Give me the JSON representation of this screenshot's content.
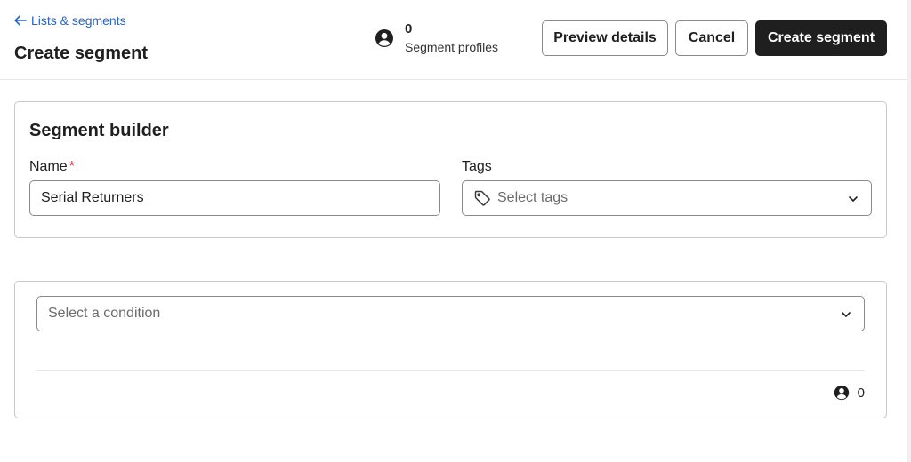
{
  "header": {
    "back_link": "Lists & segments",
    "title": "Create segment",
    "profile_count": "0",
    "profile_label": "Segment profiles",
    "preview_button": "Preview details",
    "cancel_button": "Cancel",
    "create_button": "Create segment"
  },
  "builder": {
    "title": "Segment builder",
    "name_label": "Name",
    "required_mark": "*",
    "name_value": "Serial Returners",
    "tags_label": "Tags",
    "tags_placeholder": "Select tags"
  },
  "condition": {
    "placeholder": "Select a condition",
    "count": "0"
  },
  "icons": {
    "back": "arrow-left-icon",
    "profiles": "user-circle-icon",
    "tag": "tag-icon",
    "dropdown": "chevron-down-icon"
  },
  "colors": {
    "link": "#2563c9",
    "primary_button": "#1f1f1f",
    "required": "#d0222f"
  }
}
